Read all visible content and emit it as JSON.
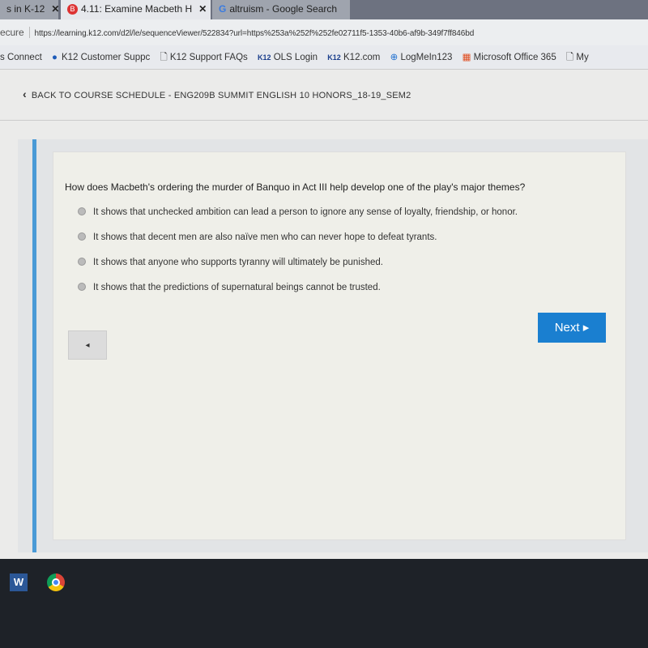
{
  "browser": {
    "tabs": [
      {
        "label": "s in K-12"
      },
      {
        "label": "4.11: Examine Macbeth H",
        "active": true
      },
      {
        "label": "altruism - Google Search"
      }
    ],
    "security": "ecure",
    "url": "https://learning.k12.com/d2l/le/sequenceViewer/522834?url=https%253a%252f%252fe02711f5-1353-40b6-af9b-349f7ff846bd",
    "bookmarks": [
      "s Connect",
      "K12 Customer Suppc",
      "K12 Support FAQs",
      "OLS Login",
      "K12.com",
      "LogMeIn123",
      "Microsoft Office 365",
      "My"
    ],
    "k12_badge": "K12"
  },
  "page": {
    "back_link": "BACK TO COURSE SCHEDULE - ENG209B SUMMIT ENGLISH 10 HONORS_18-19_SEM2",
    "question": "How does Macbeth's ordering the murder of Banquo in Act III help develop one of the play's major themes?",
    "options": [
      "It shows that unchecked ambition can lead a person to ignore any sense of loyalty, friendship, or honor.",
      "It shows that decent men are also naïve men who can never hope to defeat tyrants.",
      "It shows that anyone who supports tyranny will ultimately be punished.",
      "It shows that the predictions of supernatural beings cannot be trusted."
    ],
    "next_label": "Next ▸",
    "prev_label": "◂",
    "accent": "#1a7fd0"
  },
  "taskbar": {
    "icons": [
      "word-icon",
      "chrome-icon"
    ]
  }
}
